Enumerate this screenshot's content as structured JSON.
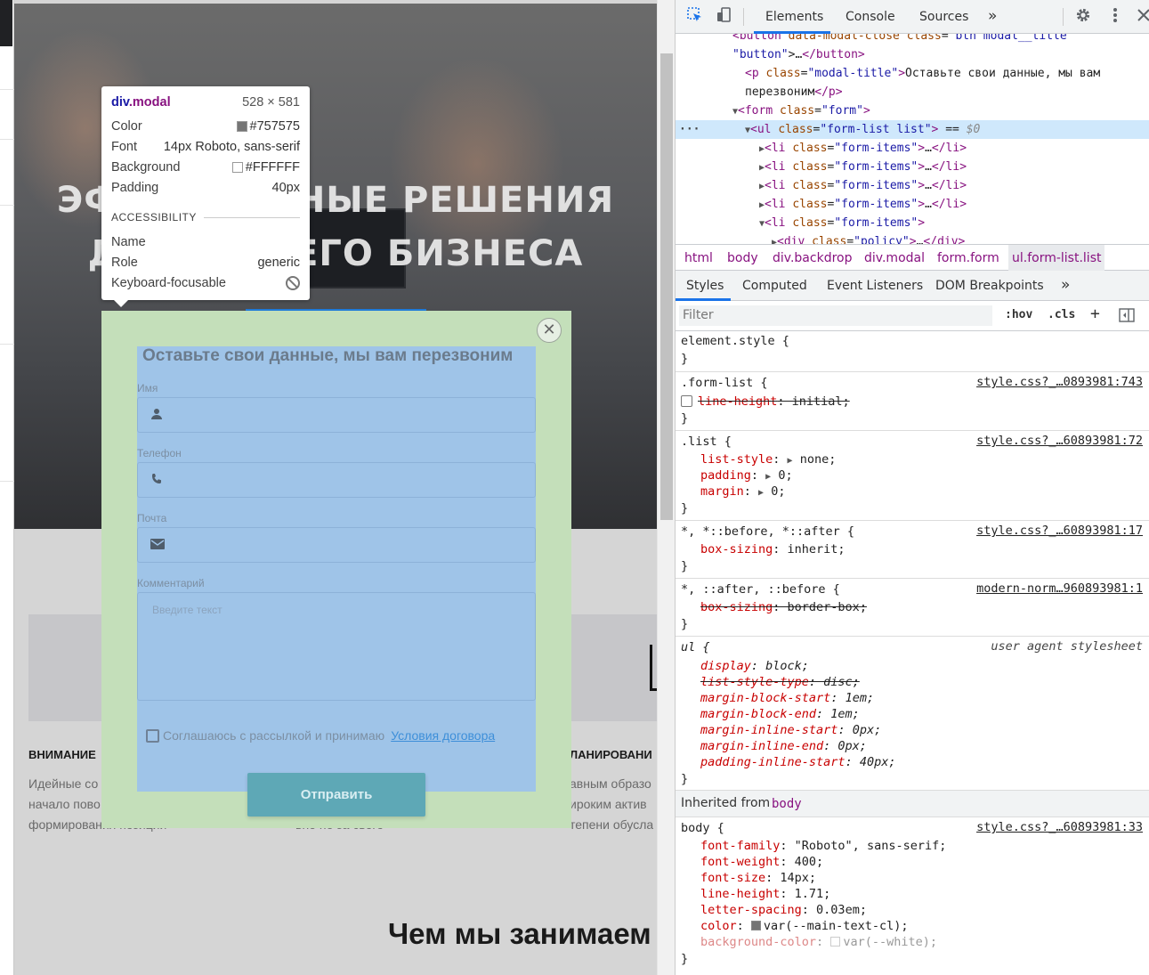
{
  "page": {
    "hero_line1": "ЭФФЕКТИВНЫЕ РЕШЕНИЯ",
    "hero_line2": "ДЛЯ ВАШЕГО БИЗНЕСА",
    "features": [
      {
        "heading": "ВНИМАНИЕ",
        "lines": [
          "Идейные со",
          "начало пово",
          "формирования позиции"
        ]
      },
      {
        "heading": "",
        "lines": [
          "",
          "",
          "вне не за свого"
        ]
      },
      {
        "heading": "ЛАНИРОВАНИ",
        "lines": [
          "авным образо",
          "ироким актив",
          "тепени обусла"
        ]
      }
    ],
    "section_title": "Чем мы занимаем"
  },
  "modal": {
    "title": "Оставьте свои данные, мы вам перезвоним",
    "close": "✕",
    "fields": [
      {
        "label": "Имя",
        "icon": "person-icon"
      },
      {
        "label": "Телефон",
        "icon": "phone-icon"
      },
      {
        "label": "Почта",
        "icon": "mail-icon"
      }
    ],
    "comment_label": "Комментарий",
    "comment_placeholder": "Введите текст",
    "agree_text": "Соглашаюсь с рассылкой и принимаю",
    "agree_link": "Условия договора",
    "submit": "Отправить",
    "colors": {
      "margin": "#c4dfba",
      "content": "#9fc4e8"
    }
  },
  "tooltip": {
    "tag": "div",
    "cls": ".modal",
    "size": "528 × 581",
    "rows": [
      {
        "k": "Color",
        "v": "#757575",
        "swatch": "#757575"
      },
      {
        "k": "Font",
        "v": "14px Roboto, sans-serif"
      },
      {
        "k": "Background",
        "v": "#FFFFFF",
        "swatch": "#FFFFFF"
      },
      {
        "k": "Padding",
        "v": "40px"
      }
    ],
    "accessibility": "ACCESSIBILITY",
    "a11y": [
      {
        "k": "Name",
        "v": ""
      },
      {
        "k": "Role",
        "v": "generic"
      },
      {
        "k": "Keyboard-focusable",
        "v": ""
      }
    ]
  },
  "devtools": {
    "tabs": [
      "Elements",
      "Console",
      "Sources",
      "»"
    ],
    "dom": [
      {
        "ind": 64,
        "html": "<span class='t-tag'>&lt;button</span> <span class='t-attr'>data-modal-close</span> <span class='t-attr'>class</span>=<span class='t-val'>\"btn modal__title\"</span>"
      },
      {
        "ind": 64,
        "html": "<span class='t-val'>\"button\"</span>&gt;…<span class='t-tag'>&lt;/button&gt;</span>"
      },
      {
        "ind": 78,
        "html": "<span class='t-tag'>&lt;p</span> <span class='t-attr'>class</span>=<span class='t-val'>\"modal-title\"</span><span class='t-tag'>&gt;</span>Оставьте свои данные, мы вам"
      },
      {
        "ind": 78,
        "html": "перезвоним<span class='t-tag'>&lt;/p&gt;</span>"
      },
      {
        "ind": 64,
        "html": "<span class='tri'>▼</span><span class='t-tag'>&lt;form</span> <span class='t-attr'>class</span>=<span class='t-val'>\"form\"</span><span class='t-tag'>&gt;</span>"
      },
      {
        "ind": 78,
        "html": "<span class='tri'>▼</span><span class='t-tag'>&lt;ul</span> <span class='t-attr'>class</span>=<span class='t-val'>\"form-list list\"</span><span class='t-tag'>&gt;</span> == <span class='t-eq'>$0</span>",
        "sel": true
      },
      {
        "ind": 94,
        "html": "<span class='tri'>▶</span><span class='t-tag'>&lt;li</span> <span class='t-attr'>class</span>=<span class='t-val'>\"form-items\"</span><span class='t-tag'>&gt;</span>…<span class='t-tag'>&lt;/li&gt;</span>"
      },
      {
        "ind": 94,
        "html": "<span class='tri'>▶</span><span class='t-tag'>&lt;li</span> <span class='t-attr'>class</span>=<span class='t-val'>\"form-items\"</span><span class='t-tag'>&gt;</span>…<span class='t-tag'>&lt;/li&gt;</span>"
      },
      {
        "ind": 94,
        "html": "<span class='tri'>▶</span><span class='t-tag'>&lt;li</span> <span class='t-attr'>class</span>=<span class='t-val'>\"form-items\"</span><span class='t-tag'>&gt;</span>…<span class='t-tag'>&lt;/li&gt;</span>"
      },
      {
        "ind": 94,
        "html": "<span class='tri'>▶</span><span class='t-tag'>&lt;li</span> <span class='t-attr'>class</span>=<span class='t-val'>\"form-items\"</span><span class='t-tag'>&gt;</span>…<span class='t-tag'>&lt;/li&gt;</span>"
      },
      {
        "ind": 94,
        "html": "<span class='tri'>▼</span><span class='t-tag'>&lt;li</span> <span class='t-attr'>class</span>=<span class='t-val'>\"form-items\"</span><span class='t-tag'>&gt;</span>"
      },
      {
        "ind": 108,
        "html": "<span class='tri'>▶</span><span class='t-tag'>&lt;div</span> <span class='t-attr'>class</span>=<span class='t-val'>\"policy\"</span><span class='t-tag'>&gt;</span>…<span class='t-tag'>&lt;/div&gt;</span>"
      }
    ],
    "breadcrumbs": [
      "html",
      "body",
      "div.backdrop",
      "div.modal",
      "form.form",
      "ul.form-list.list"
    ],
    "subtabs": [
      "Styles",
      "Computed",
      "Event Listeners",
      "DOM Breakpoints",
      "»"
    ],
    "filter_placeholder": "Filter",
    "hov": ":hov",
    "cls": ".cls",
    "plus": "+",
    "inherited_label": "Inherited from",
    "inherited_from": "body"
  }
}
